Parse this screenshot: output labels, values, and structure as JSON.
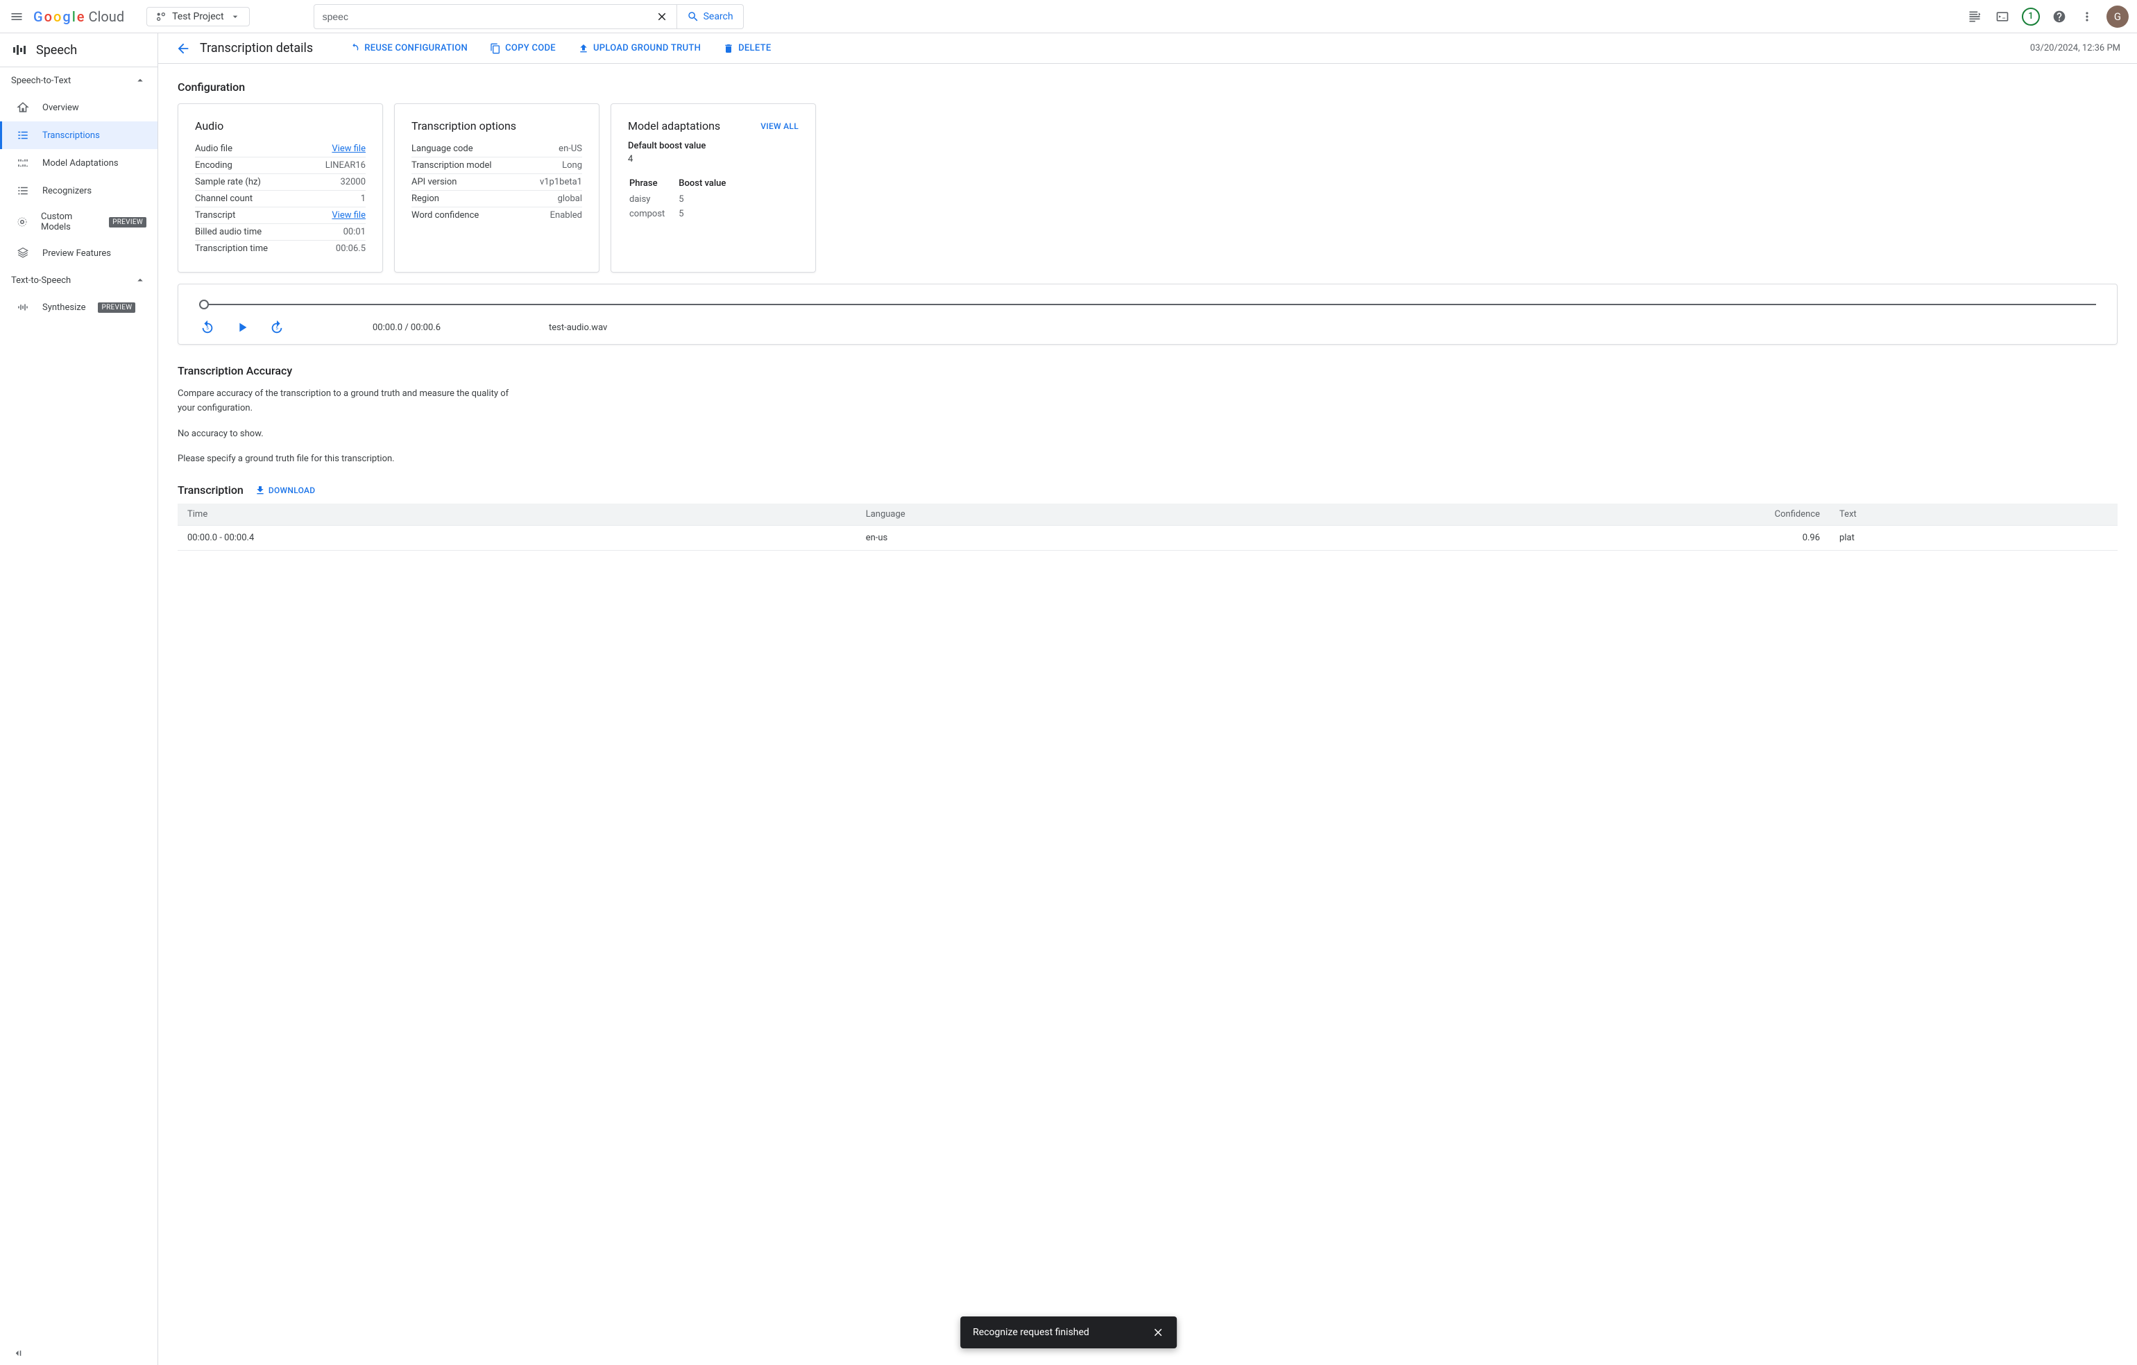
{
  "header": {
    "brand_cloud": "Cloud",
    "project_name": "Test Project",
    "search_value": "speec",
    "search_button": "Search",
    "notification_count": "1",
    "avatar_initial": "G"
  },
  "sidebar": {
    "product": "Speech",
    "sections": {
      "stt_label": "Speech-to-Text",
      "tts_label": "Text-to-Speech"
    },
    "items": {
      "overview": "Overview",
      "transcriptions": "Transcriptions",
      "model_adaptations": "Model Adaptations",
      "recognizers": "Recognizers",
      "custom_models": "Custom Models",
      "preview_features": "Preview Features",
      "synthesize": "Synthesize"
    },
    "preview_chip": "PREVIEW"
  },
  "content_header": {
    "title": "Transcription details",
    "reuse": "REUSE CONFIGURATION",
    "copy": "COPY CODE",
    "upload": "UPLOAD GROUND TRUTH",
    "delete": "DELETE",
    "timestamp": "03/20/2024, 12:36 PM"
  },
  "config": {
    "section_title": "Configuration",
    "audio": {
      "title": "Audio",
      "rows": {
        "audio_file_label": "Audio file",
        "audio_file_val": "View file",
        "encoding_label": "Encoding",
        "encoding_val": "LINEAR16",
        "sample_rate_label": "Sample rate (hz)",
        "sample_rate_val": "32000",
        "channel_label": "Channel count",
        "channel_val": "1",
        "transcript_label": "Transcript",
        "transcript_val": "View file",
        "billed_label": "Billed audio time",
        "billed_val": "00:01",
        "trans_time_label": "Transcription time",
        "trans_time_val": "00:06.5"
      }
    },
    "options": {
      "title": "Transcription options",
      "rows": {
        "lang_label": "Language code",
        "lang_val": "en-US",
        "model_label": "Transcription model",
        "model_val": "Long",
        "api_label": "API version",
        "api_val": "v1p1beta1",
        "region_label": "Region",
        "region_val": "global",
        "conf_label": "Word confidence",
        "conf_val": "Enabled"
      }
    },
    "adapt": {
      "title": "Model adaptations",
      "view_all": "VIEW ALL",
      "default_boost_label": "Default boost value",
      "default_boost_val": "4",
      "phrase_hdr": "Phrase",
      "boost_hdr": "Boost value",
      "rows": [
        {
          "phrase": "daisy",
          "boost": "5"
        },
        {
          "phrase": "compost",
          "boost": "5"
        }
      ]
    }
  },
  "player": {
    "time": "00:00.0 / 00:00.6",
    "filename": "test-audio.wav"
  },
  "accuracy": {
    "title": "Transcription Accuracy",
    "desc": "Compare accuracy of the transcription to a ground truth and measure the quality of your configuration.",
    "empty": "No accuracy to show.",
    "hint": "Please specify a ground truth file for this transcription."
  },
  "transcription": {
    "title": "Transcription",
    "download": "DOWNLOAD",
    "columns": {
      "time": "Time",
      "lang": "Language",
      "conf": "Confidence",
      "text": "Text"
    },
    "rows": [
      {
        "time": "00:00.0 - 00:00.4",
        "lang": "en-us",
        "conf": "0.96",
        "text": "plat"
      }
    ]
  },
  "toast": {
    "message": "Recognize request finished"
  }
}
